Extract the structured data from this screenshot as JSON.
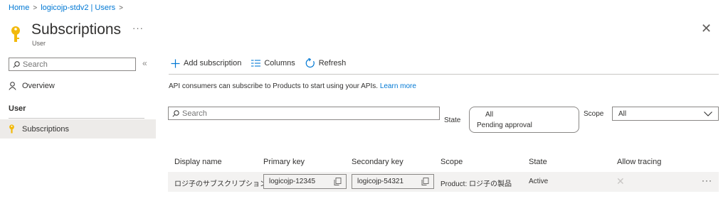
{
  "breadcrumb": {
    "items": [
      "Home",
      "logicojp-stdv2 | Users"
    ],
    "separator": ">"
  },
  "header": {
    "title": "Subscriptions",
    "subtitle": "User",
    "more": "···",
    "close": "✕"
  },
  "sidebar": {
    "search_placeholder": "Search",
    "collapse": "«",
    "overview_label": "Overview",
    "section_label": "User",
    "subscriptions_label": "Subscriptions"
  },
  "toolbar": {
    "add_label": "Add subscription",
    "columns_label": "Columns",
    "refresh_label": "Refresh"
  },
  "info": {
    "text": "API consumers can subscribe to Products to start using your APIs.",
    "link": "Learn more"
  },
  "filters": {
    "search_placeholder": "Search",
    "state_label": "State",
    "state_options": [
      "All",
      "Pending approval"
    ],
    "scope_label": "Scope",
    "scope_value": "All"
  },
  "table": {
    "headers": [
      "Display name",
      "Primary key",
      "Secondary key",
      "Scope",
      "State",
      "Allow tracing"
    ],
    "rows": [
      {
        "display_name": "ロジ子のサブスクリプション",
        "primary_key": "logicojp-12345",
        "secondary_key": "logicojp-54321",
        "scope": "Product: ロジ子の製品",
        "state": "Active",
        "tracing": "✕",
        "more": "···"
      }
    ]
  },
  "colors": {
    "accent": "#0078d4",
    "key_icon": "#f2b90c",
    "selected_bg": "#edebe9"
  }
}
